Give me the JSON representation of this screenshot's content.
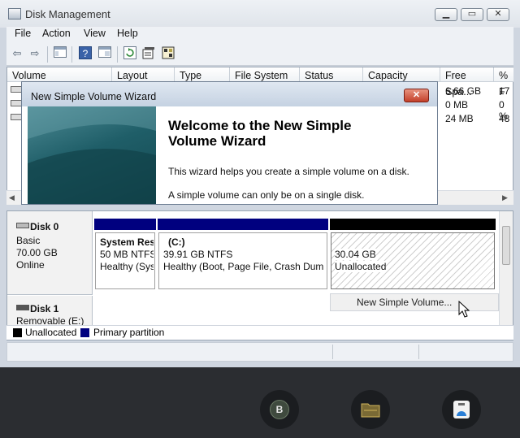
{
  "window": {
    "title": "Disk Management"
  },
  "menu": [
    "File",
    "Action",
    "View",
    "Help"
  ],
  "toolbar_icons": [
    "back-arrow-icon",
    "forward-arrow-icon",
    "console-tree-icon",
    "help-icon",
    "show-pane-icon",
    "refresh-icon",
    "properties-icon",
    "settings-icon"
  ],
  "volume_list": {
    "columns": [
      "Volume",
      "Layout",
      "Type",
      "File System",
      "Status",
      "Capacity",
      "Free Spa...",
      "% F"
    ],
    "rows": [
      {
        "free": "6.66 GB",
        "pct": "17"
      },
      {
        "free": "0 MB",
        "pct": "0 %"
      },
      {
        "free": "24 MB",
        "pct": "48"
      }
    ]
  },
  "wizard": {
    "title": "New Simple Volume Wizard",
    "heading_line1": "Welcome to the New Simple",
    "heading_line2": "Volume Wizard",
    "text1": "This wizard helps you create a simple volume on a disk.",
    "text2": "A simple volume can only be on a single disk."
  },
  "disks": [
    {
      "name": "Disk 0",
      "type": "Basic",
      "size": "70.00 GB",
      "status": "Online",
      "partitions": [
        {
          "name": "System Res",
          "detail": "50 MB NTFS",
          "status": "Healthy (Sys"
        },
        {
          "name": "(C:)",
          "detail": "39.91 GB NTFS",
          "status": "Healthy (Boot, Page File, Crash Dump"
        },
        {
          "name": "",
          "detail": "30.04 GB",
          "status": "Unallocated"
        }
      ]
    },
    {
      "name": "Disk 1",
      "type": "Removable (E:)"
    }
  ],
  "context_menu": {
    "item": "New Simple Volume..."
  },
  "legend": [
    {
      "label": "Unallocated",
      "color": "#000000"
    },
    {
      "label": "Primary partition",
      "color": "#00007f"
    }
  ],
  "colors": {
    "primary_bar": "#00007f",
    "unallocated_bar": "#000000",
    "wizard_side": "#1f5e68"
  },
  "dock_items": [
    {
      "icon": "b-app-icon",
      "letter": "B"
    },
    {
      "icon": "folder-icon"
    },
    {
      "icon": "remote-icon"
    }
  ]
}
